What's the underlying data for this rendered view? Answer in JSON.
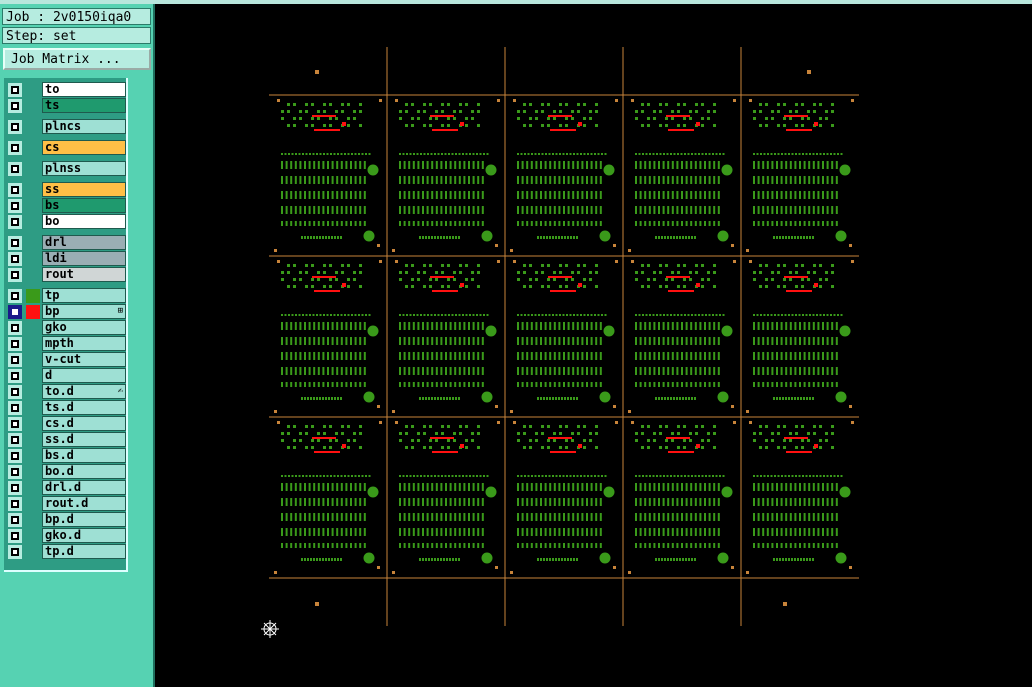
{
  "job": {
    "label": "Job : 2v0150iqa0",
    "step": "Step: set",
    "matrix_button": "Job Matrix ..."
  },
  "layers": [
    {
      "name": "to",
      "color": "#ffffff",
      "swatch": "",
      "checked": false,
      "mark": ""
    },
    {
      "name": "ts",
      "color": "#1f9a6e",
      "swatch": "",
      "checked": false,
      "mark": ""
    },
    {
      "name": "plncs",
      "color": "#9ee0d4",
      "swatch": "",
      "checked": false,
      "mark": ""
    },
    {
      "name": "cs",
      "color": "#ffbf46",
      "swatch": "",
      "checked": false,
      "mark": ""
    },
    {
      "name": "plnss",
      "color": "#9ee0d4",
      "swatch": "",
      "checked": false,
      "mark": ""
    },
    {
      "name": "ss",
      "color": "#ffbf46",
      "swatch": "",
      "checked": false,
      "mark": ""
    },
    {
      "name": "bs",
      "color": "#1f9a6e",
      "swatch": "",
      "checked": false,
      "mark": ""
    },
    {
      "name": "bo",
      "color": "#ffffff",
      "swatch": "",
      "checked": false,
      "mark": ""
    },
    {
      "name": "drl",
      "color": "#9aaeb4",
      "swatch": "",
      "checked": false,
      "mark": ""
    },
    {
      "name": "ldi",
      "color": "#9aaeb4",
      "swatch": "",
      "checked": false,
      "mark": ""
    },
    {
      "name": "rout",
      "color": "#d0d6d6",
      "swatch": "",
      "checked": false,
      "mark": ""
    },
    {
      "name": "tp",
      "color": "#9ee0d4",
      "swatch": "#3a9a1a",
      "checked": false,
      "mark": ""
    },
    {
      "name": "bp",
      "color": "#9ee0d4",
      "swatch": "#ff1010",
      "checked": true,
      "mark": "⊞"
    },
    {
      "name": "gko",
      "color": "#9ee0d4",
      "swatch": "",
      "checked": false,
      "mark": ""
    },
    {
      "name": "mpth",
      "color": "#9ee0d4",
      "swatch": "",
      "checked": false,
      "mark": ""
    },
    {
      "name": "v-cut",
      "color": "#9ee0d4",
      "swatch": "",
      "checked": false,
      "mark": ""
    },
    {
      "name": "d",
      "color": "#9ee0d4",
      "swatch": "",
      "checked": false,
      "mark": ""
    },
    {
      "name": "to.d",
      "color": "#9ee0d4",
      "swatch": "",
      "checked": false,
      "mark": "✍"
    },
    {
      "name": "ts.d",
      "color": "#9ee0d4",
      "swatch": "",
      "checked": false,
      "mark": ""
    },
    {
      "name": "cs.d",
      "color": "#9ee0d4",
      "swatch": "",
      "checked": false,
      "mark": ""
    },
    {
      "name": "ss.d",
      "color": "#9ee0d4",
      "swatch": "",
      "checked": false,
      "mark": ""
    },
    {
      "name": "bs.d",
      "color": "#9ee0d4",
      "swatch": "",
      "checked": false,
      "mark": ""
    },
    {
      "name": "bo.d",
      "color": "#9ee0d4",
      "swatch": "",
      "checked": false,
      "mark": ""
    },
    {
      "name": "drl.d",
      "color": "#9ee0d4",
      "swatch": "",
      "checked": false,
      "mark": ""
    },
    {
      "name": "rout.d",
      "color": "#9ee0d4",
      "swatch": "",
      "checked": false,
      "mark": ""
    },
    {
      "name": "bp.d",
      "color": "#9ee0d4",
      "swatch": "",
      "checked": false,
      "mark": ""
    },
    {
      "name": "gko.d",
      "color": "#9ee0d4",
      "swatch": "",
      "checked": false,
      "mark": ""
    },
    {
      "name": "tp.d",
      "color": "#9ee0d4",
      "swatch": "",
      "checked": false,
      "mark": ""
    }
  ],
  "layout": {
    "group_starts": [
      0,
      2,
      3,
      4,
      5,
      8,
      11
    ]
  },
  "canvas": {
    "panel_rows": 3,
    "panel_cols": 5,
    "colors": {
      "profile": "#c8843a",
      "copper": "#3a9a1a",
      "marker": "#ff1010",
      "background": "#000000"
    },
    "snap_icon": "crosshair-snap-icon"
  }
}
